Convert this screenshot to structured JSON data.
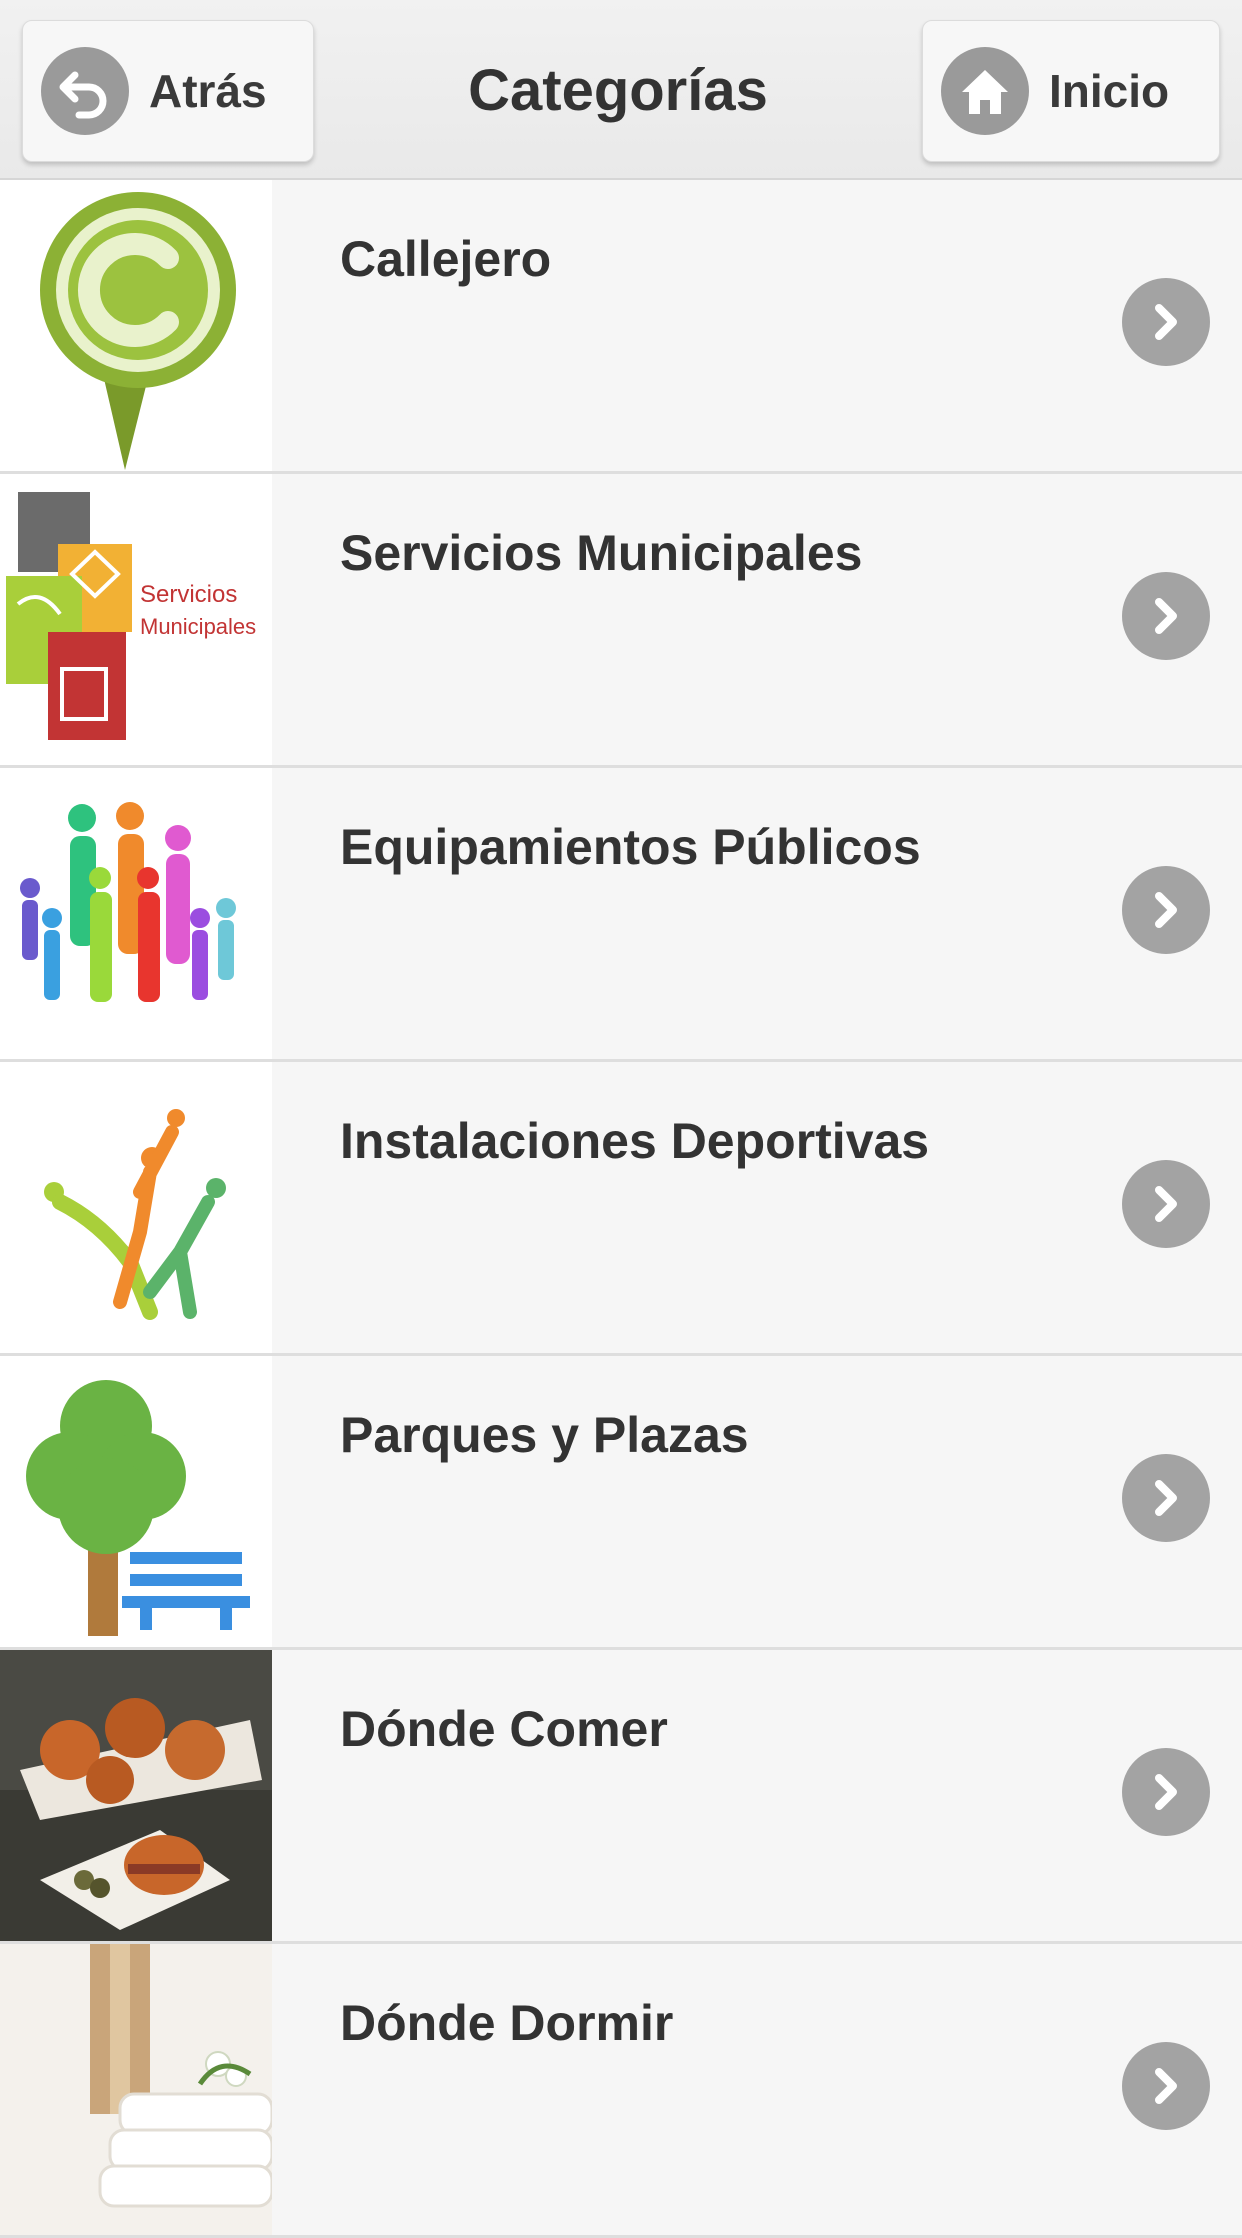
{
  "header": {
    "title": "Categorías",
    "back_label": "Atrás",
    "home_label": "Inicio"
  },
  "categories": [
    {
      "label": "Callejero",
      "icon": "callejero-pin-icon"
    },
    {
      "label": "Servicios Municipales",
      "icon": "servicios-municipales-icon",
      "logo_text_1": "Servicios",
      "logo_text_2": "Municipales"
    },
    {
      "label": "Equipamientos Públicos",
      "icon": "people-group-icon"
    },
    {
      "label": "Instalaciones Deportivas",
      "icon": "sports-players-icon"
    },
    {
      "label": "Parques y Plazas",
      "icon": "tree-bench-icon"
    },
    {
      "label": "Dónde Comer",
      "icon": "food-photo"
    },
    {
      "label": "Dónde Dormir",
      "icon": "towels-photo"
    }
  ],
  "colors": {
    "background": "#f6f6f6",
    "header": "#ececec",
    "chevron": "#a3a3a3",
    "text": "#333333"
  }
}
